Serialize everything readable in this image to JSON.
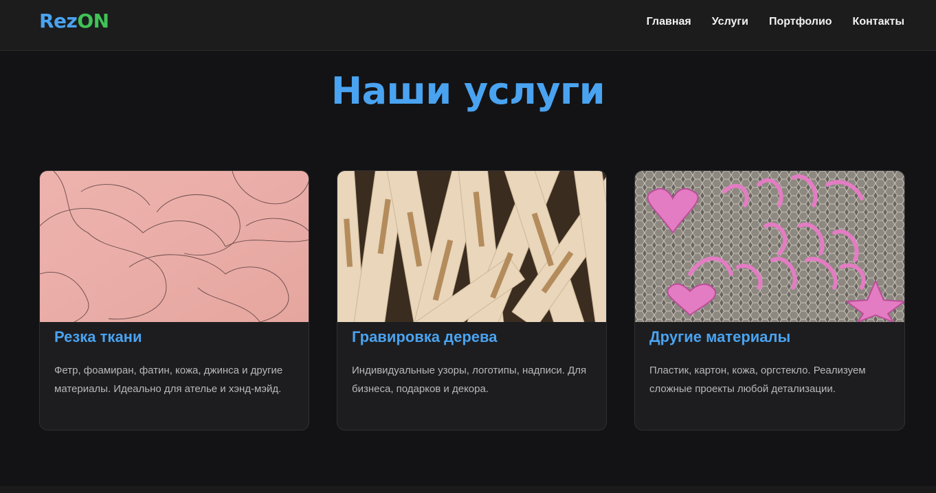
{
  "header": {
    "logo_part1": "Rez",
    "logo_part2": "ON",
    "nav": [
      {
        "label": "Главная"
      },
      {
        "label": "Услуги"
      },
      {
        "label": "Портфолио"
      },
      {
        "label": "Контакты"
      }
    ]
  },
  "main": {
    "title": "Наши услуги",
    "cards": [
      {
        "title": "Резка ткани",
        "text": "Фетр, фоамиран, фатин, кожа, джинса и другие материалы. Идеально для ателье и хэнд-мэйд.",
        "image": "pink-fabric-with-cut-outlines"
      },
      {
        "title": "Гравировка дерева",
        "text": "Индивидуальные узоры, логотипы, надписи. Для бизнеса, подарков и декора.",
        "image": "engraved-wooden-sticks"
      },
      {
        "title": "Другие материалы",
        "text": "Пластик, картон, кожа, оргстекло. Реализуем сложные проекты любой детализации.",
        "image": "pink-acrylic-letters-on-honeycomb-bed"
      }
    ]
  },
  "colors": {
    "accent_blue": "#4aa3f0",
    "accent_green": "#3fc257",
    "background": "#131315",
    "card": "#1d1d1f"
  }
}
